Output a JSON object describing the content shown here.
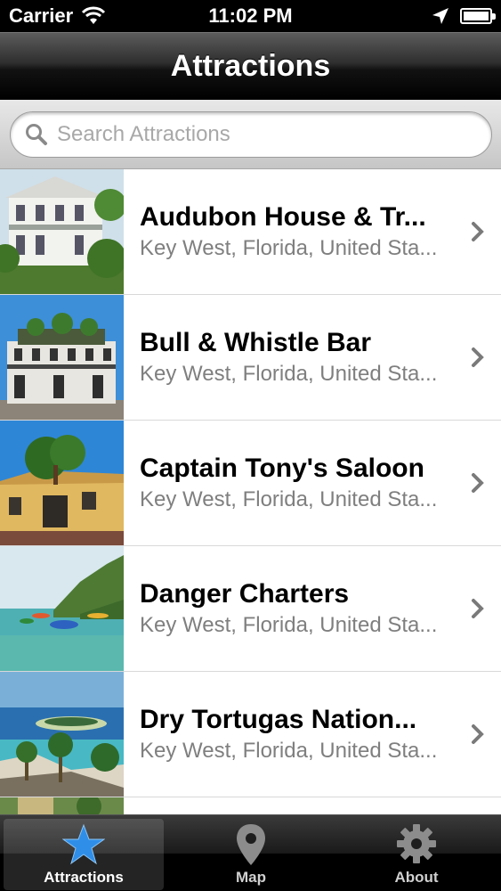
{
  "status_bar": {
    "carrier": "Carrier",
    "time": "11:02 PM"
  },
  "nav": {
    "title": "Attractions"
  },
  "search": {
    "placeholder": "Search Attractions",
    "value": ""
  },
  "attractions": [
    {
      "title": "Audubon House & Tr...",
      "subtitle": "Key West, Florida, United Sta..."
    },
    {
      "title": "Bull & Whistle Bar",
      "subtitle": "Key West, Florida, United Sta..."
    },
    {
      "title": "Captain Tony's Saloon",
      "subtitle": "Key West, Florida, United Sta..."
    },
    {
      "title": "Danger Charters",
      "subtitle": "Key West, Florida, United Sta..."
    },
    {
      "title": "Dry Tortugas Nation...",
      "subtitle": "Key West, Florida, United Sta..."
    }
  ],
  "tabs": [
    {
      "label": "Attractions",
      "icon": "star-icon",
      "active": true
    },
    {
      "label": "Map",
      "icon": "map-pin-icon",
      "active": false
    },
    {
      "label": "About",
      "icon": "gear-icon",
      "active": false
    }
  ],
  "colors": {
    "tab_active_icon": "#2f8ee8",
    "subtitle": "#7f7f7f"
  }
}
